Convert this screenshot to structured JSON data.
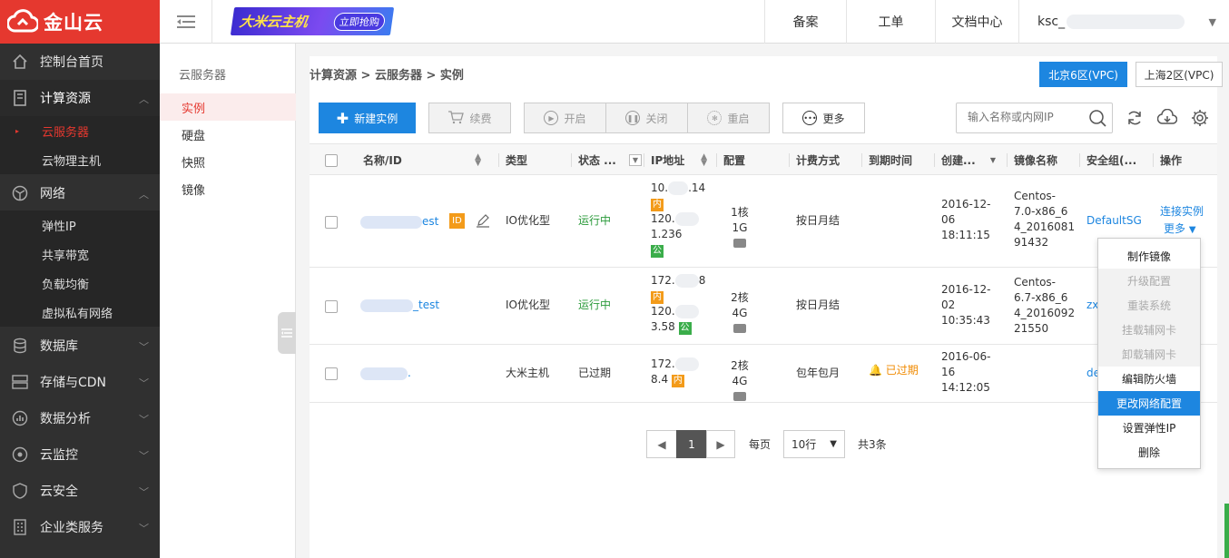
{
  "brand": {
    "name": "金山云"
  },
  "header": {
    "banner_title": "大米云主机",
    "banner_cta": "立即抢购",
    "nav": [
      "备案",
      "工单",
      "文档中心"
    ],
    "user": "ksc_"
  },
  "sidebar": {
    "home": "控制台首页",
    "compute": {
      "label": "计算资源",
      "items": [
        "云服务器",
        "云物理主机"
      ]
    },
    "network": {
      "label": "网络",
      "items": [
        "弹性IP",
        "共享带宽",
        "负载均衡",
        "虚拟私有网络"
      ]
    },
    "database": "数据库",
    "storage": "存储与CDN",
    "analytics": "数据分析",
    "monitor": "云监控",
    "security": "云安全",
    "enterprise": "企业类服务"
  },
  "subnav": {
    "title": "云服务器",
    "items": [
      "实例",
      "硬盘",
      "快照",
      "镜像"
    ]
  },
  "breadcrumb": "计算资源 > 云服务器 > 实例",
  "regions": [
    "北京6区(VPC)",
    "上海2区(VPC)"
  ],
  "toolbar": {
    "create": "新建实例",
    "renew": "续费",
    "start": "开启",
    "stop": "关闭",
    "restart": "重启",
    "more": "更多",
    "search_placeholder": "输入名称或内网IP"
  },
  "table": {
    "headers": [
      "名称/ID",
      "类型",
      "状态 ...",
      "IP地址",
      "配置",
      "计费方式",
      "到期时间",
      "创建...",
      "镜像名称",
      "安全组(...",
      "操作"
    ],
    "rows": [
      {
        "name_suffix": "est",
        "type": "IO优化型",
        "status": "运行中",
        "ip_inner_a": "10.",
        "ip_inner_b": ".14",
        "ip_pub_a": "120.",
        "ip_pub_b": "1.236",
        "config": "1核1G",
        "billing": "按日月结",
        "expire": "",
        "created_date_a": "2016-12-",
        "created_date_b": "06",
        "created_time": "18:11:15",
        "image_l1": "Centos-",
        "image_l2": "7.0-x86_6",
        "image_l3": "4_2016081",
        "image_l4": "91432",
        "security_group": "DefaultSG",
        "op_connect": "连接实例",
        "op_more": "更多"
      },
      {
        "name_suffix": "_test",
        "type": "IO优化型",
        "status": "运行中",
        "ip_inner_a": "172.",
        "ip_inner_b": "8",
        "ip_pub_a": "120.",
        "ip_pub_b": "3.58",
        "config": "2核4G",
        "billing": "按日月结",
        "expire": "",
        "created_date_a": "2016-12-",
        "created_date_b": "02",
        "created_time": "10:35:43",
        "image_l1": "Centos-",
        "image_l2": "6.7-x86_6",
        "image_l3": "4_2016092",
        "image_l4": "21550",
        "security_group": "zx"
      },
      {
        "name_suffix": ".",
        "type": "大米主机",
        "status": "已过期",
        "ip_inner_a": "172.",
        "ip_inner_b": "8.4",
        "config": "2核4G",
        "billing": "包年包月",
        "expire": "已过期",
        "created_date_a": "2016-06-",
        "created_date_b": "16",
        "created_time": "14:12:05",
        "security_group": "de"
      }
    ],
    "tag_inner": "内",
    "tag_public": "公"
  },
  "dropdown": [
    "制作镜像",
    "升级配置",
    "重装系统",
    "挂载辅网卡",
    "卸载辅网卡",
    "编辑防火墙",
    "更改网络配置",
    "设置弹性IP",
    "删除"
  ],
  "pagination": {
    "current": "1",
    "per_page_label": "每页",
    "per_page": "10行",
    "total": "共3条"
  },
  "colors": {
    "brand_red": "#e5382f",
    "primary_blue": "#1d86e0",
    "sidebar_bg": "#303030"
  }
}
